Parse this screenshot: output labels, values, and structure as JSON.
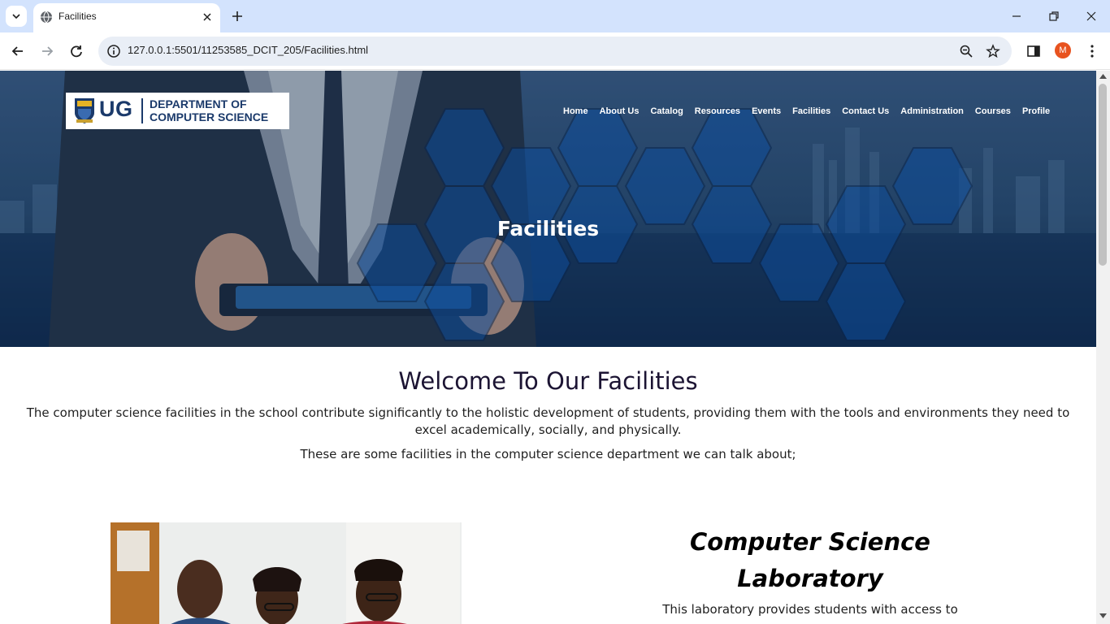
{
  "browser": {
    "tab_title": "Facilities",
    "url": "127.0.0.1:5501/11253585_DCIT_205/Facilities.html",
    "profile_initial": "M"
  },
  "site": {
    "logo": {
      "mark": "UG",
      "line1": "DEPARTMENT OF",
      "line2": "COMPUTER SCIENCE"
    },
    "nav": [
      "Home",
      "About Us",
      "Catalog",
      "Resources",
      "Events",
      "Facilities",
      "Contact Us",
      "Administration",
      "Courses",
      "Profile"
    ]
  },
  "hero": {
    "title": "Facilities"
  },
  "welcome": {
    "heading": "Welcome To Our Facilities",
    "intro": "The computer science facilities in the school contribute significantly to the holistic development of students, providing them with the tools and environments they need to excel academically, socially, and physically.",
    "intro2": "These are some facilities in the computer science department we can talk about;"
  },
  "facility": {
    "title": "Computer Science Laboratory",
    "description": "This laboratory provides students with access to"
  },
  "colors": {
    "hero_blue": "#1b3d63",
    "logo_navy": "#1b3a6b",
    "heading_dark": "#1c1433",
    "chrome_tab": "#d3e3fd",
    "avatar": "#e8531f"
  }
}
